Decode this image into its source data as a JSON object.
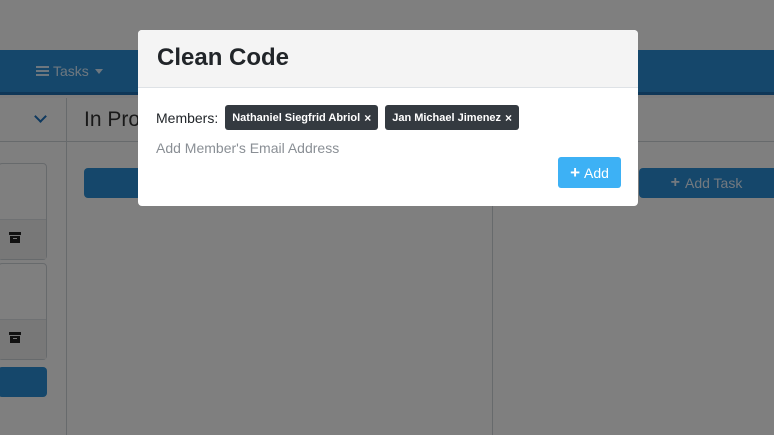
{
  "nav": {
    "tasks_label": "Tasks",
    "tasks_icon": "list-icon"
  },
  "board": {
    "column_mid_title": "In Pro",
    "add_task_label": "Add Task"
  },
  "modal": {
    "title": "Clean Code",
    "members_label": "Members:",
    "members": [
      {
        "name": "Nathaniel Siegfrid Abriol",
        "remove": "×"
      },
      {
        "name": "Jan Michael Jimenez",
        "remove": "×"
      }
    ],
    "email_placeholder": "Add Member's Email Address",
    "add_button_label": "Add"
  },
  "colors": {
    "primary": "#2a8fd6",
    "add_button": "#3db1f5",
    "tag_bg": "#343a40"
  }
}
